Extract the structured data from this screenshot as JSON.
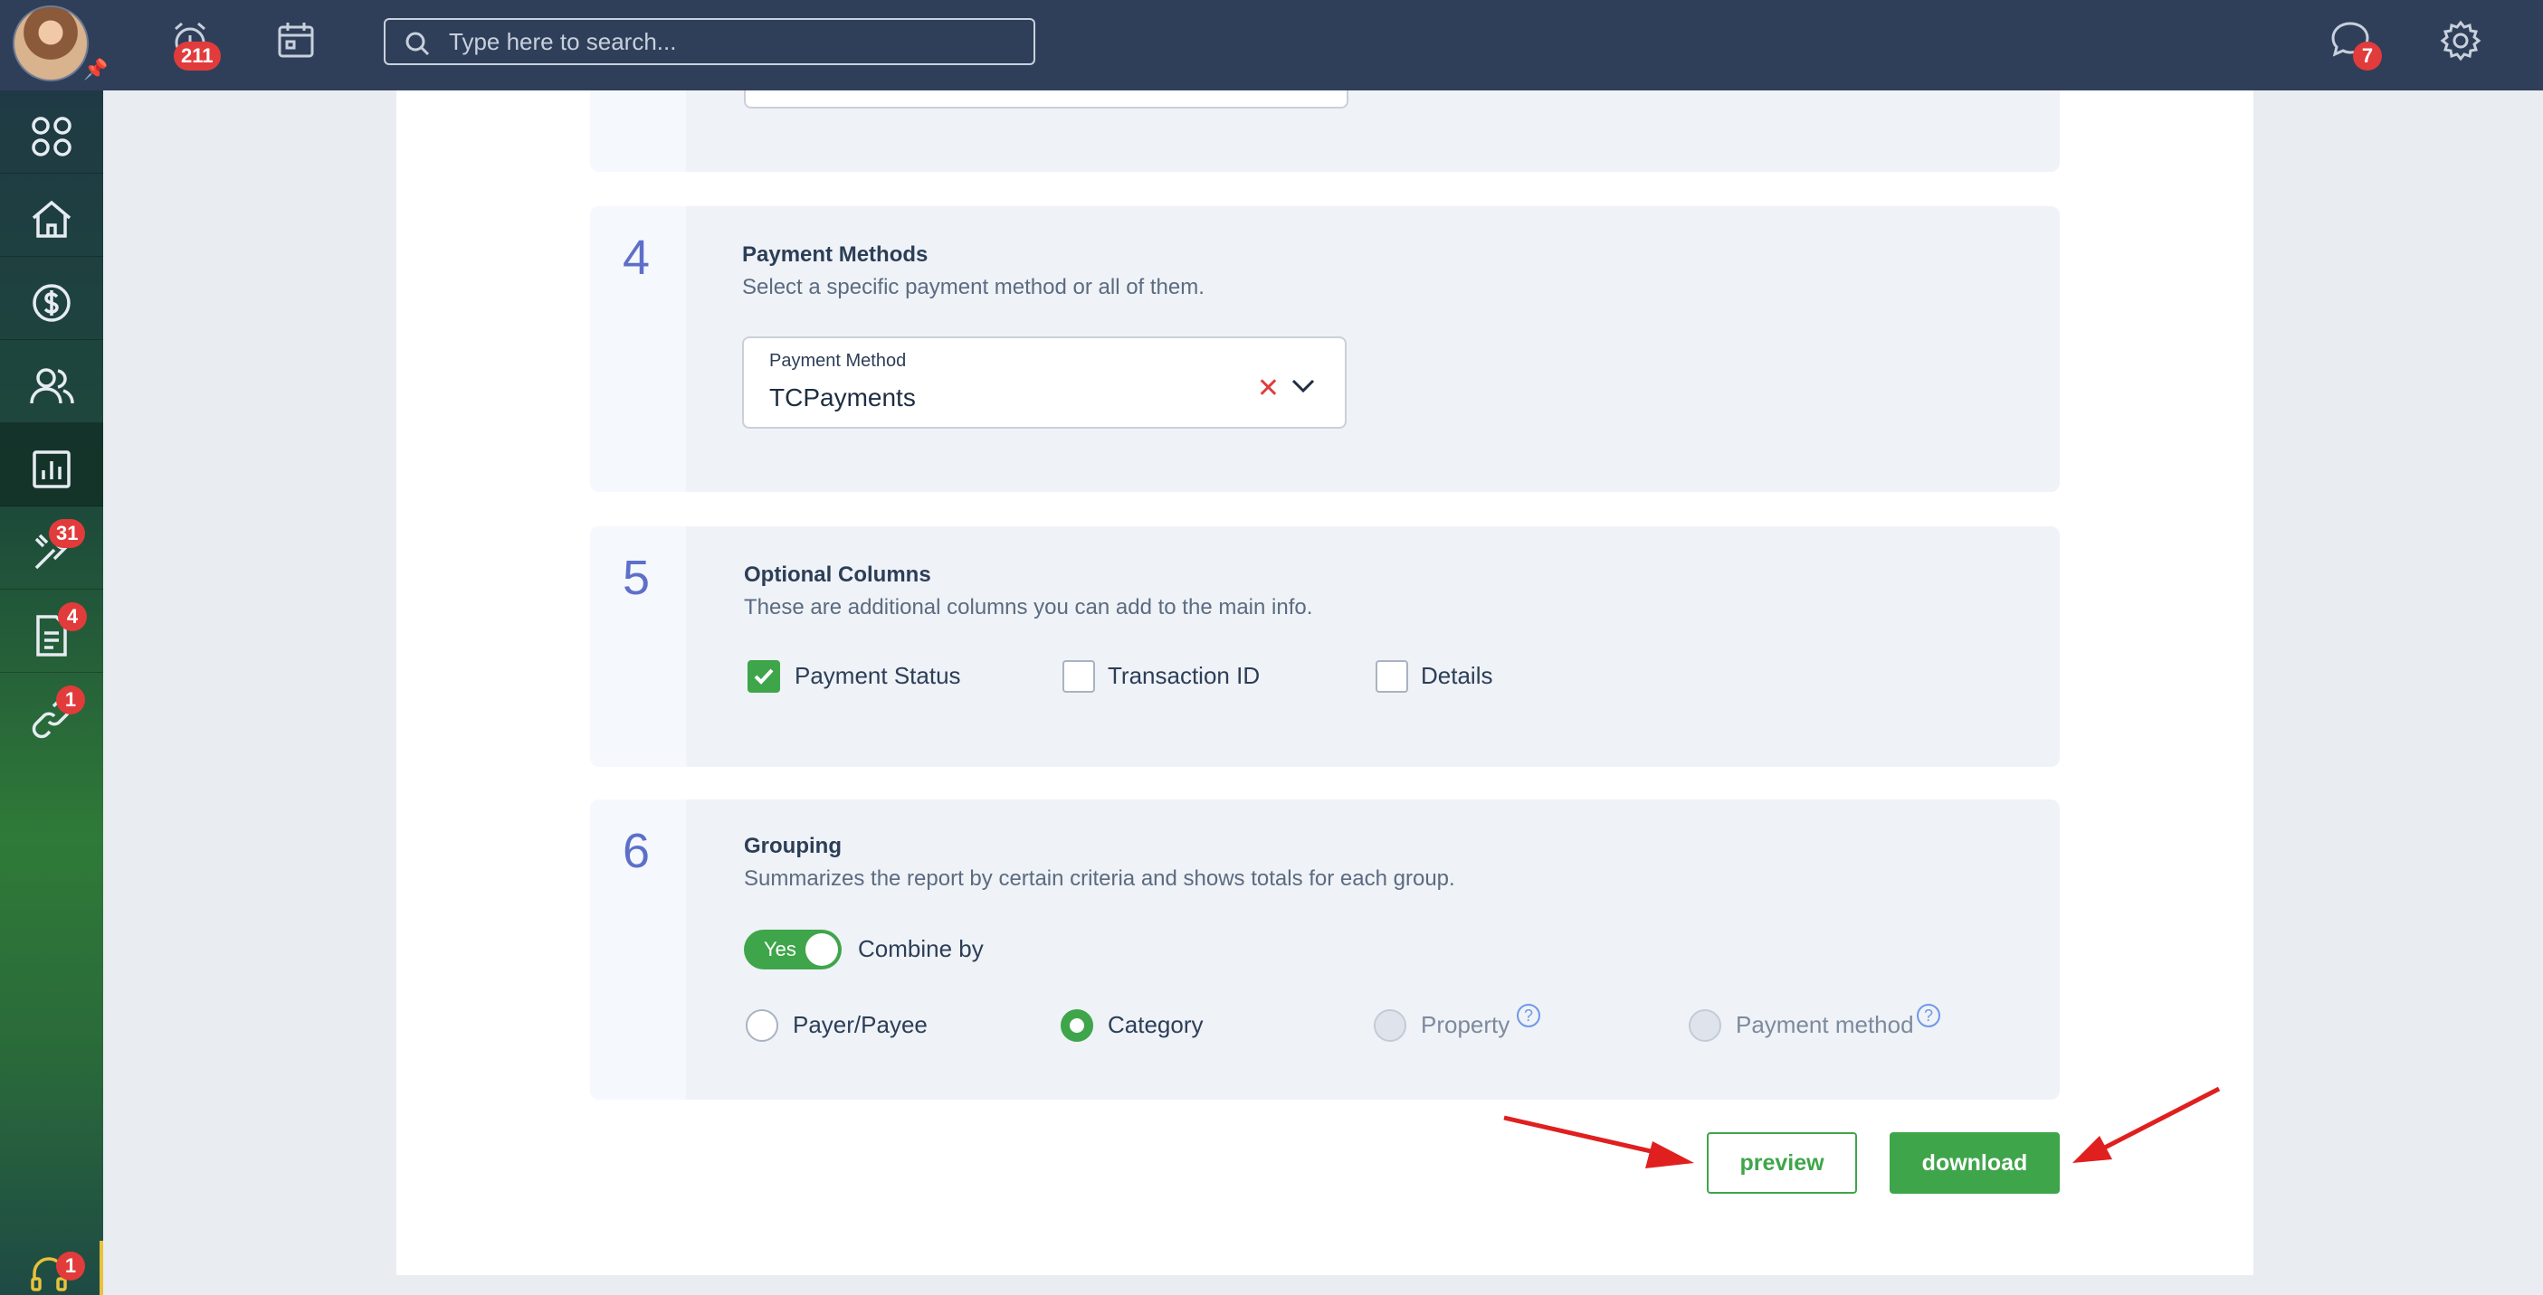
{
  "topbar": {
    "search_placeholder": "Type here to search...",
    "alarm_badge": "211",
    "messages_badge": "7"
  },
  "sidebar": {
    "items": [
      {
        "icon": "apps-grid-icon"
      },
      {
        "icon": "home-icon"
      },
      {
        "icon": "dollar-icon"
      },
      {
        "icon": "users-icon"
      },
      {
        "icon": "reports-icon",
        "active": true
      },
      {
        "icon": "tools-icon",
        "badge": "31"
      },
      {
        "icon": "document-icon",
        "badge": "4"
      },
      {
        "icon": "link-icon",
        "badge": "1"
      }
    ],
    "support_badge": "1"
  },
  "sections": {
    "payment_methods": {
      "number": "4",
      "title": "Payment Methods",
      "description": "Select a specific payment method or all of them.",
      "select_label": "Payment Method",
      "select_value": "TCPayments"
    },
    "optional_columns": {
      "number": "5",
      "title": "Optional Columns",
      "description": "These are additional columns you can add to the main info.",
      "options": [
        {
          "label": "Payment Status",
          "checked": true
        },
        {
          "label": "Transaction ID",
          "checked": false
        },
        {
          "label": "Details",
          "checked": false
        }
      ]
    },
    "grouping": {
      "number": "6",
      "title": "Grouping",
      "description": "Summarizes the report by certain criteria and shows totals for each group.",
      "toggle_label": "Yes",
      "combine_label": "Combine by",
      "options": [
        {
          "label": "Payer/Payee",
          "selected": false,
          "disabled": false
        },
        {
          "label": "Category",
          "selected": true,
          "disabled": false
        },
        {
          "label": "Property",
          "selected": false,
          "disabled": true
        },
        {
          "label": "Payment method",
          "selected": false,
          "disabled": true
        }
      ]
    }
  },
  "actions": {
    "preview_label": "preview",
    "download_label": "download"
  },
  "colors": {
    "topbar": "#2f3f5a",
    "accent_green": "#3fa54a",
    "badge_red": "#e23b3b",
    "step_number": "#5e6fc9"
  }
}
